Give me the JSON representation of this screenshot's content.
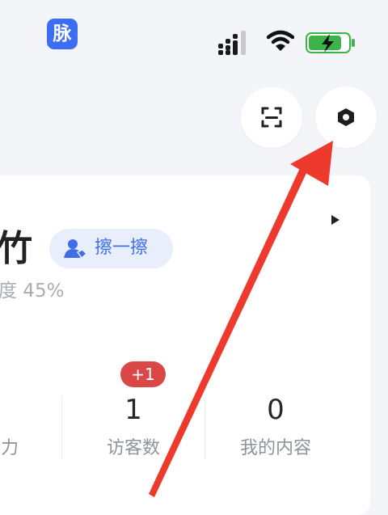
{
  "status_bar": {
    "app_icon_char": "脉",
    "app_icon_color": "#3b6ef5",
    "battery_color": "#3cb44a",
    "icons": [
      "signal-icon",
      "wifi-icon",
      "battery-charging-icon"
    ]
  },
  "header": {
    "buttons": [
      {
        "name": "scan-button",
        "icon": "scan-icon"
      },
      {
        "name": "settings-button",
        "icon": "settings-hexagon-icon"
      }
    ]
  },
  "profile": {
    "name_visible": "竹",
    "wipe_label": "擦一擦",
    "degree_text": "度 45%"
  },
  "stats": [
    {
      "value": "",
      "label": "力"
    },
    {
      "value": "1",
      "label": "访客数",
      "badge": "+1"
    },
    {
      "value": "0",
      "label": "我的内容"
    }
  ],
  "colors": {
    "accent": "#3f6ee8",
    "badge": "#d94747",
    "annotation_arrow": "#ee3a2c"
  }
}
